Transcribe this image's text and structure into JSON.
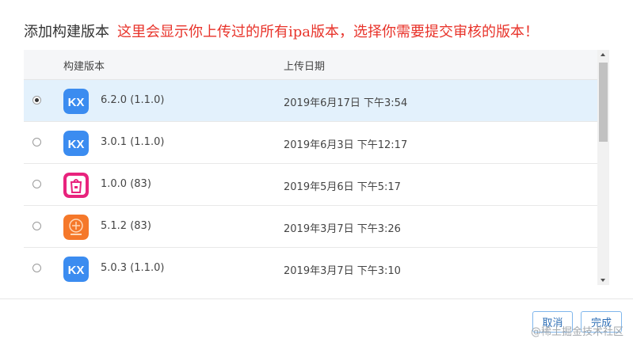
{
  "dialog": {
    "title": "添加构建版本",
    "annotation": "这里会显示你上传过的所有ipa版本，选择你需要提交审核的版本！"
  },
  "table": {
    "headers": {
      "build": "构建版本",
      "upload_date": "上传日期"
    },
    "rows": [
      {
        "version": "6.2.0 (1.1.0)",
        "date": "2019年6月17日 下午3:54",
        "icon": "kx-app-icon",
        "selected": true
      },
      {
        "version": "3.0.1 (1.1.0)",
        "date": "2019年6月3日 下午12:17",
        "icon": "kx-app-icon",
        "selected": false
      },
      {
        "version": "1.0.0 (83)",
        "date": "2019年5月6日 下午5:17",
        "icon": "shopping-bag-app-icon",
        "selected": false
      },
      {
        "version": "5.1.2 (83)",
        "date": "2019年3月7日 下午3:26",
        "icon": "orange-app-icon",
        "selected": false
      },
      {
        "version": "5.0.3 (1.1.0)",
        "date": "2019年3月7日 下午3:10",
        "icon": "kx-app-icon",
        "selected": false
      }
    ]
  },
  "icon_text": {
    "kx": "KX"
  },
  "buttons": {
    "cancel": "取消",
    "done": "完成"
  },
  "watermark": "@稀土掘金技术社区",
  "colors": {
    "annotation": "#e8332a",
    "selected_row": "#e3f1fc",
    "button_text": "#2f6fb6",
    "kx_blue": "#3b8cf0"
  }
}
